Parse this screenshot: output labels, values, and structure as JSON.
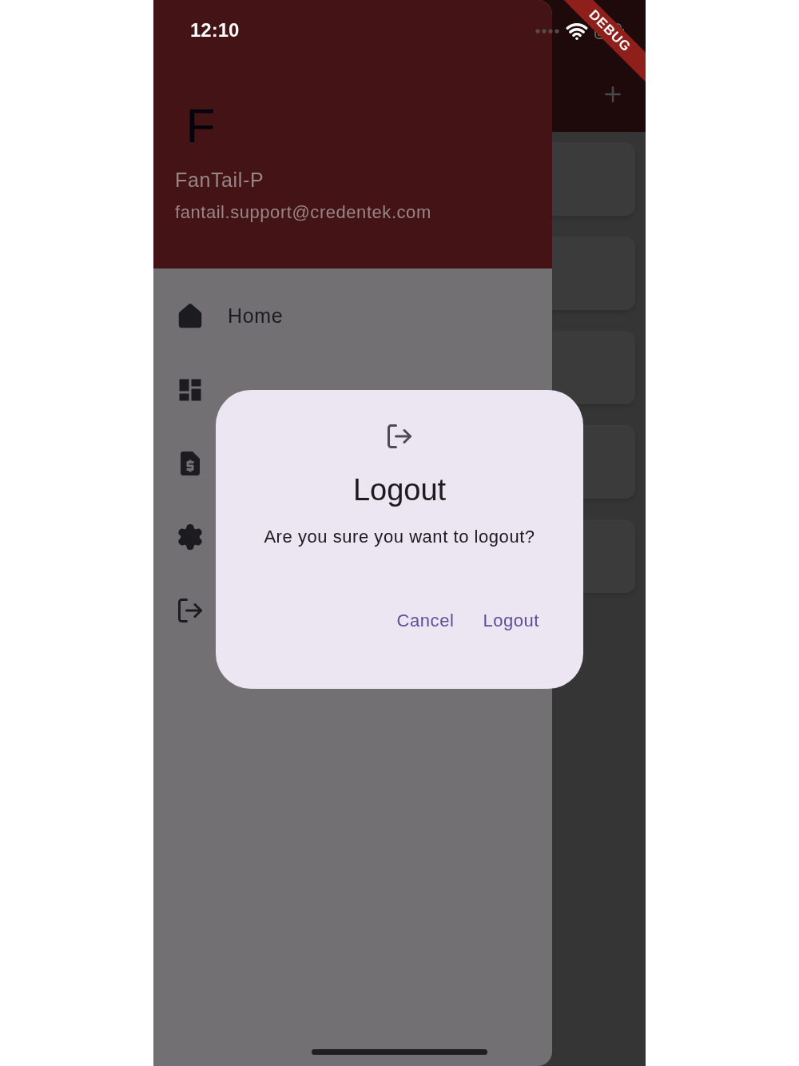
{
  "status_bar": {
    "time": "12:10"
  },
  "debug_banner": "DEBUG",
  "drawer": {
    "header": {
      "avatar": "F",
      "name": "FanTail-P",
      "email": "fantail.support@credentek.com"
    },
    "items": [
      {
        "label": "Home"
      }
    ]
  },
  "dialog": {
    "title": "Logout",
    "message": "Are you sure you want to logout?",
    "buttons": [
      "Cancel",
      "Logout"
    ]
  }
}
